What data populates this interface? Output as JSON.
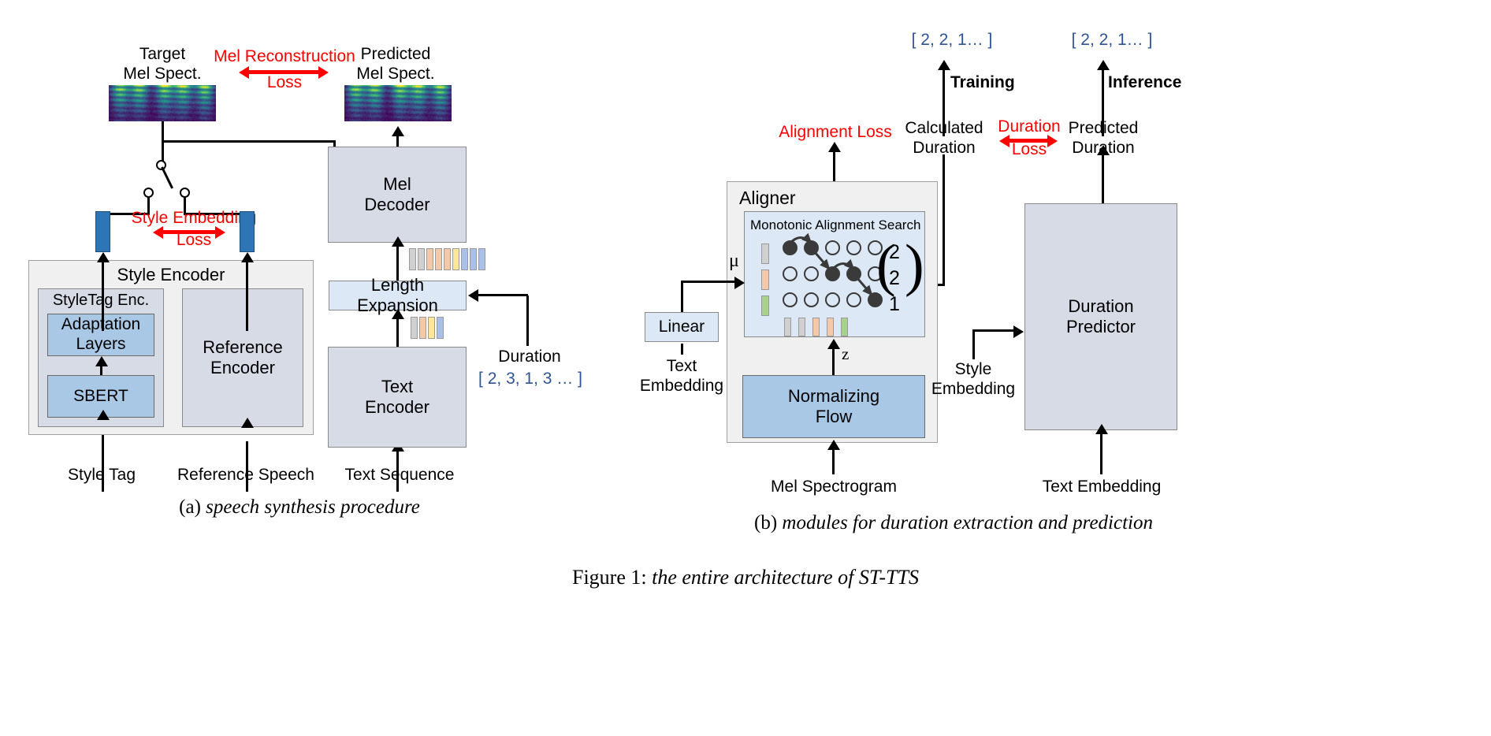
{
  "figure": {
    "number": "Figure 1:",
    "title": "the entire architecture of ST-TTS"
  },
  "colors": {
    "red_loss": "#ff0000",
    "blue_text": "#2e5496",
    "box_gray": "#d6dbe6",
    "box_blue": "#a8c8e6",
    "box_light_blue": "#dce8f5",
    "embedding_bar": "#2e75b6",
    "group_bg": "#f0f0f0"
  },
  "panel_a": {
    "caption_label": "(a)",
    "caption_text": "speech synthesis procedure",
    "target_spec_label": "Target\nMel Spect.",
    "predicted_spec_label": "Predicted\nMel Spect.",
    "mel_recon_loss": "Mel Reconstruction",
    "mel_recon_loss_2": "Loss",
    "style_embedding_loss": "Style Embedding",
    "style_embedding_loss_2": "Loss",
    "mel_decoder": "Mel\nDecoder",
    "length_expansion": "Length Expansion",
    "text_encoder": "Text\nEncoder",
    "style_encoder": "Style Encoder",
    "styletag_enc": "StyleTag Enc.",
    "adaptation_layers": "Adaptation\nLayers",
    "sbert": "SBERT",
    "reference_encoder": "Reference\nEncoder",
    "duration_label": "Duration",
    "duration_values": "[ 2, 3, 1, 3 … ]",
    "input_style_tag": "Style Tag",
    "input_reference_speech": "Reference Speech",
    "input_text_sequence": "Text Sequence",
    "tokens_before": [
      "#d0d0d0",
      "#f5c9a8",
      "#ffe699",
      "#a9c0e8"
    ],
    "tokens_after": [
      "#d0d0d0",
      "#d0d0d0",
      "#f5c9a8",
      "#f5c9a8",
      "#f5c9a8",
      "#ffe699",
      "#a9c0e8",
      "#a9c0e8",
      "#a9c0e8"
    ]
  },
  "panel_b": {
    "caption_label": "(b)",
    "caption_text": "modules for duration extraction and prediction",
    "training_output": "[ 2, 2, 1… ]",
    "inference_output": "[ 2, 2, 1… ]",
    "training_label": "Training",
    "inference_label": "Inference",
    "alignment_loss": "Alignment Loss",
    "calculated_duration": "Calculated\nDuration",
    "duration_loss": "Duration",
    "duration_loss_2": "Loss",
    "predicted_duration": "Predicted\nDuration",
    "aligner": "Aligner",
    "mas_title": "Monotonic Alignment Search",
    "linear": "Linear",
    "text_embedding_left": "Text\nEmbedding",
    "normalizing_flow": "Normalizing\nFlow",
    "mu_symbol": "μ",
    "z_symbol": "z",
    "mel_spectrogram_input": "Mel Spectrogram",
    "duration_predictor": "Duration\nPredictor",
    "style_embedding_input": "Style\nEmbedding",
    "text_embedding_input": "Text Embedding",
    "mas_row_colors": [
      "#d0d0d0",
      "#f5c9a8",
      "#a9d18e"
    ],
    "mas_col_colors": [
      "#d0d0d0",
      "#d0d0d0",
      "#f5c9a8",
      "#f5c9a8",
      "#a9d18e"
    ],
    "mas_duration_vector": [
      "2",
      "2",
      "1"
    ],
    "mas_path": [
      {
        "row": 0,
        "col": 0
      },
      {
        "row": 0,
        "col": 1
      },
      {
        "row": 1,
        "col": 2
      },
      {
        "row": 1,
        "col": 3
      },
      {
        "row": 2,
        "col": 4
      }
    ],
    "mas_rows": 3,
    "mas_cols": 5
  }
}
